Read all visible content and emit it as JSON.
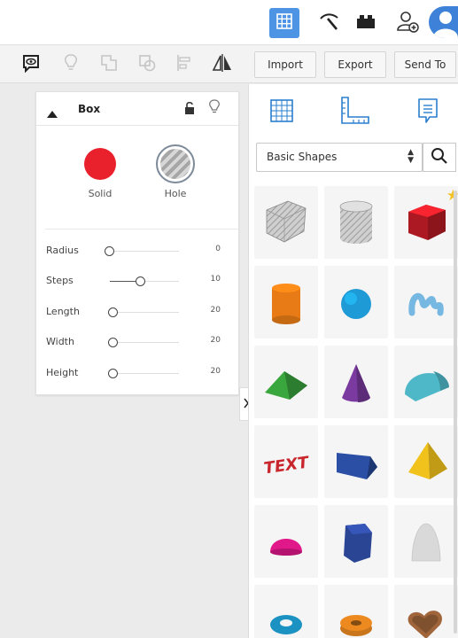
{
  "colors": {
    "accent_blue": "#4e94e5",
    "solid_red": "#e8212d",
    "panel_bg": "#ffffff",
    "workplane_bg": "#ebebeb"
  },
  "topbar": {
    "buttons": [
      {
        "name": "3d-design-view",
        "icon": "grid-icon",
        "active": true
      },
      {
        "name": "blocks-view",
        "icon": "pickaxe-icon",
        "active": false
      },
      {
        "name": "bricks-view",
        "icon": "brick-icon",
        "active": false
      },
      {
        "name": "invite-collaborators",
        "icon": "add-user-icon",
        "active": false
      },
      {
        "name": "user-profile",
        "icon": "avatar-icon",
        "active": false
      }
    ]
  },
  "toolbar": {
    "tools": [
      {
        "name": "notes-tool",
        "icon": "speech-eye-icon",
        "enabled": true
      },
      {
        "name": "show-all-tool",
        "icon": "lightbulb-icon",
        "enabled": false
      },
      {
        "name": "group-tool",
        "icon": "group-icon",
        "enabled": false
      },
      {
        "name": "ungroup-tool",
        "icon": "ungroup-icon",
        "enabled": false
      },
      {
        "name": "align-tool",
        "icon": "align-icon",
        "enabled": false
      },
      {
        "name": "mirror-tool",
        "icon": "mirror-icon",
        "enabled": true
      }
    ],
    "import_label": "Import",
    "export_label": "Export",
    "sendto_label": "Send To"
  },
  "inspector": {
    "title": "Box",
    "solid_label": "Solid",
    "hole_label": "Hole",
    "params": [
      {
        "label": "Radius",
        "value": "0",
        "fraction": 0.0
      },
      {
        "label": "Steps",
        "value": "10",
        "fraction": 0.45
      },
      {
        "label": "Length",
        "value": "20",
        "fraction": 0.05
      },
      {
        "label": "Width",
        "value": "20",
        "fraction": 0.05
      },
      {
        "label": "Height",
        "value": "20",
        "fraction": 0.05
      }
    ]
  },
  "shapes_panel": {
    "category": "Basic Shapes",
    "icons": [
      "workplane-icon",
      "ruler-icon",
      "notes-icon"
    ],
    "shapes": [
      {
        "name": "box-hole",
        "color": "#b9b9b9",
        "favorite": false
      },
      {
        "name": "cylinder-hole",
        "color": "#b9b9b9",
        "favorite": false
      },
      {
        "name": "box",
        "color": "#d81f2a",
        "favorite": true
      },
      {
        "name": "cylinder",
        "color": "#e87b16",
        "favorite": false
      },
      {
        "name": "sphere",
        "color": "#1e9ad6",
        "favorite": false
      },
      {
        "name": "scribble",
        "color": "#76b8e2",
        "favorite": false
      },
      {
        "name": "roof",
        "color": "#3aa63e",
        "favorite": false
      },
      {
        "name": "cone",
        "color": "#7a3aa0",
        "favorite": false
      },
      {
        "name": "round-roof",
        "color": "#4fb8c8",
        "favorite": false
      },
      {
        "name": "text",
        "color": "#c8262c",
        "favorite": false
      },
      {
        "name": "wedge",
        "color": "#2a4fa5",
        "favorite": false
      },
      {
        "name": "pyramid",
        "color": "#f1c21b",
        "favorite": false
      },
      {
        "name": "half-sphere",
        "color": "#e0188a",
        "favorite": false
      },
      {
        "name": "polygon",
        "color": "#2b4595",
        "favorite": false
      },
      {
        "name": "paraboloid",
        "color": "#d9d9d9",
        "favorite": false
      },
      {
        "name": "torus",
        "color": "#1b92c2",
        "favorite": false
      },
      {
        "name": "tube",
        "color": "#ec8a20",
        "favorite": false
      },
      {
        "name": "heart",
        "color": "#a0653b",
        "favorite": false
      }
    ]
  }
}
